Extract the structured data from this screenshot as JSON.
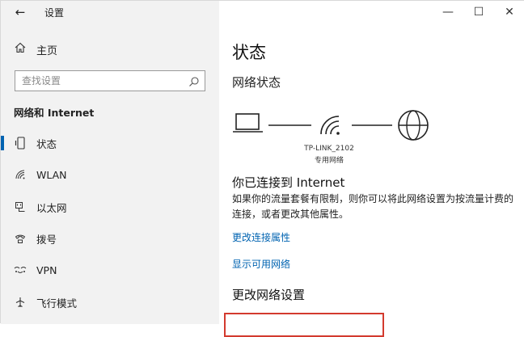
{
  "window": {
    "title": "设置",
    "controls": {
      "minimize": "—",
      "maximize": "☐",
      "close": "✕"
    }
  },
  "sidebar": {
    "home_label": "主页",
    "search_placeholder": "查找设置",
    "section_title": "网络和 Internet",
    "items": [
      {
        "label": "状态",
        "icon": "status-icon",
        "active": true
      },
      {
        "label": "WLAN",
        "icon": "wifi-icon",
        "active": false
      },
      {
        "label": "以太网",
        "icon": "ethernet-icon",
        "active": false
      },
      {
        "label": "拨号",
        "icon": "dialup-icon",
        "active": false
      },
      {
        "label": "VPN",
        "icon": "vpn-icon",
        "active": false
      },
      {
        "label": "飞行模式",
        "icon": "airplane-icon",
        "active": false
      }
    ]
  },
  "main": {
    "title": "状态",
    "network_status_heading": "网络状态",
    "network_name": "TP-LINK_2102",
    "network_type": "专用网络",
    "connected_title": "你已连接到 Internet",
    "connected_desc": "如果你的流量套餐有限制，则你可以将此网络设置为按流量计费的连接，或者更改其他属性。",
    "link_change_properties": "更改连接属性",
    "link_show_networks": "显示可用网络",
    "change_settings_heading": "更改网络设置"
  },
  "colors": {
    "accent": "#0063b1",
    "highlight_box": "#d33a2e",
    "sidebar_bg": "#f2f2f2"
  }
}
